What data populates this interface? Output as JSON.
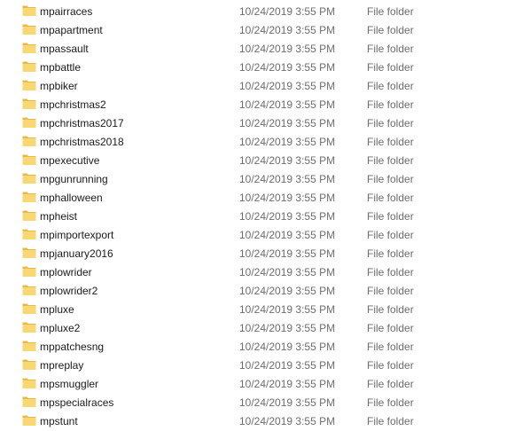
{
  "icon": "folder-icon",
  "folder_color": "#f8d775",
  "folder_back_color": "#e8b84a",
  "files": [
    {
      "name": "mpairraces",
      "date": "10/24/2019 3:55 PM",
      "type": "File folder"
    },
    {
      "name": "mpapartment",
      "date": "10/24/2019 3:55 PM",
      "type": "File folder"
    },
    {
      "name": "mpassault",
      "date": "10/24/2019 3:55 PM",
      "type": "File folder"
    },
    {
      "name": "mpbattle",
      "date": "10/24/2019 3:55 PM",
      "type": "File folder"
    },
    {
      "name": "mpbiker",
      "date": "10/24/2019 3:55 PM",
      "type": "File folder"
    },
    {
      "name": "mpchristmas2",
      "date": "10/24/2019 3:55 PM",
      "type": "File folder"
    },
    {
      "name": "mpchristmas2017",
      "date": "10/24/2019 3:55 PM",
      "type": "File folder"
    },
    {
      "name": "mpchristmas2018",
      "date": "10/24/2019 3:55 PM",
      "type": "File folder"
    },
    {
      "name": "mpexecutive",
      "date": "10/24/2019 3:55 PM",
      "type": "File folder"
    },
    {
      "name": "mpgunrunning",
      "date": "10/24/2019 3:55 PM",
      "type": "File folder"
    },
    {
      "name": "mphalloween",
      "date": "10/24/2019 3:55 PM",
      "type": "File folder"
    },
    {
      "name": "mpheist",
      "date": "10/24/2019 3:55 PM",
      "type": "File folder"
    },
    {
      "name": "mpimportexport",
      "date": "10/24/2019 3:55 PM",
      "type": "File folder"
    },
    {
      "name": "mpjanuary2016",
      "date": "10/24/2019 3:55 PM",
      "type": "File folder"
    },
    {
      "name": "mplowrider",
      "date": "10/24/2019 3:55 PM",
      "type": "File folder"
    },
    {
      "name": "mplowrider2",
      "date": "10/24/2019 3:55 PM",
      "type": "File folder"
    },
    {
      "name": "mpluxe",
      "date": "10/24/2019 3:55 PM",
      "type": "File folder"
    },
    {
      "name": "mpluxe2",
      "date": "10/24/2019 3:55 PM",
      "type": "File folder"
    },
    {
      "name": "mppatchesng",
      "date": "10/24/2019 3:55 PM",
      "type": "File folder"
    },
    {
      "name": "mpreplay",
      "date": "10/24/2019 3:55 PM",
      "type": "File folder"
    },
    {
      "name": "mpsmuggler",
      "date": "10/24/2019 3:55 PM",
      "type": "File folder"
    },
    {
      "name": "mpspecialraces",
      "date": "10/24/2019 3:55 PM",
      "type": "File folder"
    },
    {
      "name": "mpstunt",
      "date": "10/24/2019 3:55 PM",
      "type": "File folder"
    }
  ]
}
